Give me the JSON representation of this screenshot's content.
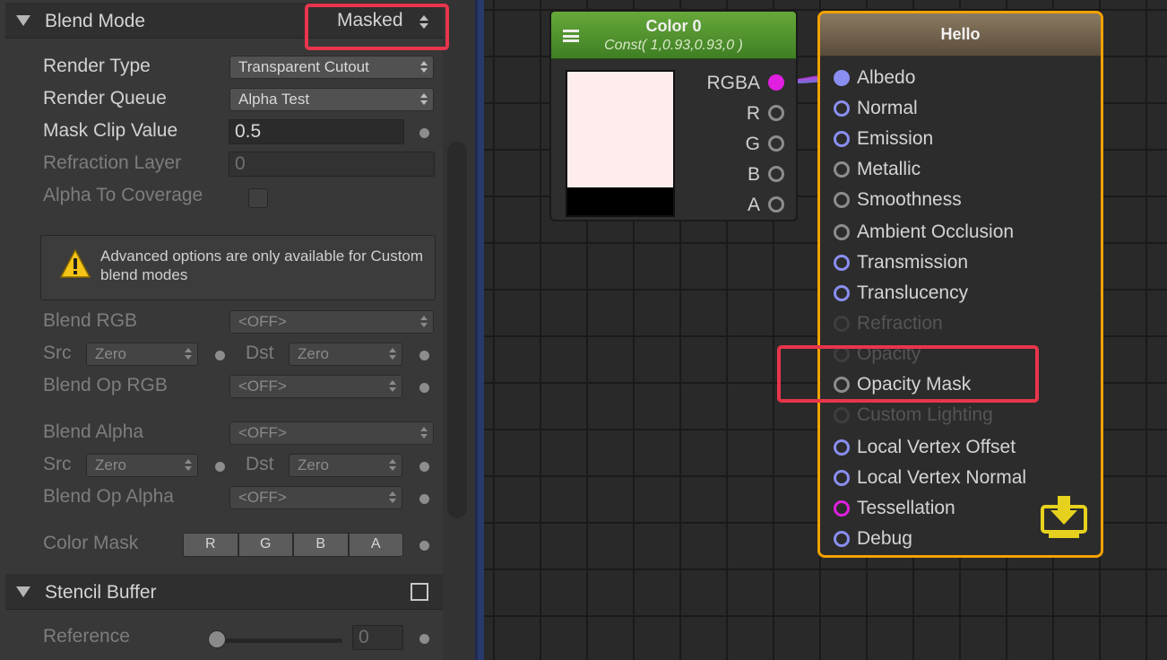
{
  "inspector": {
    "blend_mode": {
      "title": "Blend Mode",
      "value": "Masked"
    },
    "render_type": {
      "label": "Render Type",
      "value": "Transparent Cutout"
    },
    "render_queue": {
      "label": "Render Queue",
      "value": "Alpha Test"
    },
    "mask_clip": {
      "label": "Mask Clip Value",
      "value": "0.5"
    },
    "refraction_layer": {
      "label": "Refraction Layer",
      "value": "0"
    },
    "alpha_to_coverage": {
      "label": "Alpha To Coverage"
    },
    "help_message": "Advanced options are only available for Custom blend modes",
    "blend_rgb": {
      "label": "Blend RGB",
      "value": "<OFF>",
      "src_label": "Src",
      "src_value": "Zero",
      "dst_label": "Dst",
      "dst_value": "Zero",
      "op_label": "Blend Op RGB",
      "op_value": "<OFF>"
    },
    "blend_alpha": {
      "label": "Blend Alpha",
      "value": "<OFF>",
      "src_label": "Src",
      "src_value": "Zero",
      "dst_label": "Dst",
      "dst_value": "Zero",
      "op_label": "Blend Op Alpha",
      "op_value": "<OFF>"
    },
    "color_mask": {
      "label": "Color Mask",
      "channels": [
        "R",
        "G",
        "B",
        "A"
      ]
    },
    "stencil": {
      "title": "Stencil Buffer",
      "reference_label": "Reference",
      "reference_value": "0"
    }
  },
  "color_node": {
    "title": "Color 0",
    "subtitle": "Const( 1,0.93,0.93,0 )",
    "preview_color": "#ffeded",
    "outputs": [
      "RGBA",
      "R",
      "G",
      "B",
      "A"
    ]
  },
  "hello_node": {
    "title": "Hello",
    "border_color": "#f2a100",
    "inputs": [
      {
        "label": "Albedo",
        "state": "connected"
      },
      {
        "label": "Normal",
        "state": "blue"
      },
      {
        "label": "Emission",
        "state": "blue"
      },
      {
        "label": "Metallic",
        "state": "gray"
      },
      {
        "label": "Smoothness",
        "state": "gray"
      },
      {
        "label": "Ambient Occlusion",
        "state": "gray"
      },
      {
        "label": "Transmission",
        "state": "blue"
      },
      {
        "label": "Translucency",
        "state": "blue"
      },
      {
        "label": "Refraction",
        "state": "dim"
      },
      {
        "label": "Opacity",
        "state": "dim"
      },
      {
        "label": "Opacity Mask",
        "state": "gray"
      },
      {
        "label": "Custom Lighting",
        "state": "dim"
      },
      {
        "label": "Local Vertex Offset",
        "state": "blue"
      },
      {
        "label": "Local Vertex Normal",
        "state": "blue"
      },
      {
        "label": "Tessellation",
        "state": "magenta"
      },
      {
        "label": "Debug",
        "state": "blue"
      }
    ]
  },
  "colors": {
    "highlight": "#e8354b",
    "node_green": "#4f8f2c",
    "wire": "#c040e0"
  }
}
